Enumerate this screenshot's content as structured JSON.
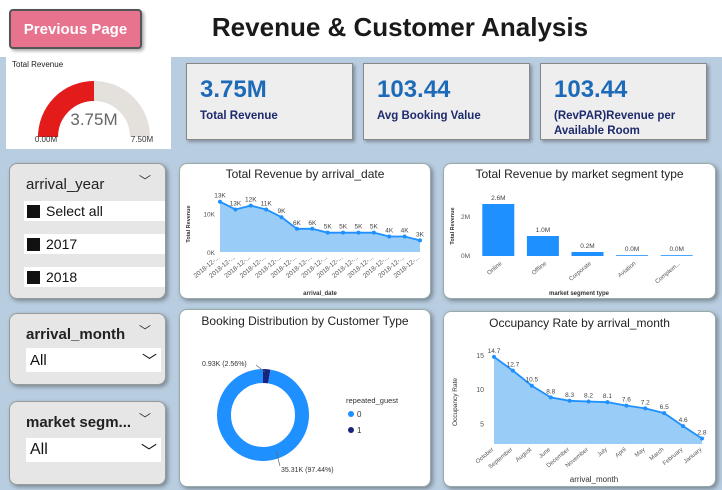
{
  "header": {
    "prev_label": "Previous Page",
    "title": "Revenue & Customer Analysis"
  },
  "gauge": {
    "label": "Total Revenue",
    "value_text": "3.75M",
    "min_text": "0.00M",
    "max_text": "7.50M",
    "fill_fraction": 0.5,
    "fill_color": "#e31b1b",
    "track_color": "#e4e0dc"
  },
  "kpis": [
    {
      "value": "3.75M",
      "label": "Total Revenue"
    },
    {
      "value": "103.44",
      "label": "Avg Booking Value"
    },
    {
      "value": "103.44",
      "label": "(RevPAR)Revenue per Available Room"
    }
  ],
  "slicers": {
    "year": {
      "title": "arrival_year",
      "options": [
        "Select all",
        "2017",
        "2018"
      ]
    },
    "month": {
      "title": "arrival_month",
      "selected": "All"
    },
    "segment": {
      "title": "market segm...",
      "selected": "All"
    }
  },
  "chart_data": [
    {
      "type": "area",
      "title": "Total Revenue by arrival_date",
      "xlabel": "arrival_date",
      "ylabel": "Total Revenue",
      "y_ticks": [
        "10K",
        "0K"
      ],
      "ylim": [
        0,
        15
      ],
      "x": [
        "2018-12-...",
        "2018-12-...",
        "2018-12-...",
        "2018-12-...",
        "2018-12-...",
        "2018-12-...",
        "2018-12-...",
        "2018-12-...",
        "2018-12-...",
        "2018-12-...",
        "2018-12-...",
        "2018-12-...",
        "2018-12-...",
        "2018-12-..."
      ],
      "values": [
        13,
        11,
        12,
        11,
        9,
        6,
        6,
        5,
        5,
        5,
        5,
        4,
        4,
        3
      ],
      "labels": [
        "13K",
        "13K",
        "12K",
        "11K",
        "9K",
        "6K",
        "6K",
        "5K",
        "5K",
        "5K",
        "5K",
        "4K",
        "4K",
        "3K"
      ],
      "color": "#1e90ff"
    },
    {
      "type": "bar",
      "title": "Total Revenue by market segment type",
      "xlabel": "market segment type",
      "ylabel": "Total Revenue",
      "y_ticks": [
        "2M",
        "0M"
      ],
      "ylim": [
        0,
        3
      ],
      "categories": [
        "Online",
        "Offline",
        "Corporate",
        "Aviation",
        "Complem..."
      ],
      "values": [
        2.6,
        1.0,
        0.2,
        0.0,
        0.0
      ],
      "labels": [
        "2.6M",
        "1.0M",
        "0.2M",
        "0.0M",
        "0.0M"
      ],
      "color": "#1e90ff"
    },
    {
      "type": "pie",
      "title": "Booking Distribution by Customer Type",
      "legend_title": "repeated_guest",
      "series": [
        {
          "name": "0",
          "value": 35.31,
          "label": "35.31K (97.44%)",
          "color": "#1e90ff"
        },
        {
          "name": "1",
          "value": 0.93,
          "label": "0.93K (2.56%)",
          "color": "#1a237e"
        }
      ]
    },
    {
      "type": "area",
      "title": "Occupancy Rate by arrival_month",
      "xlabel": "arrival_month",
      "ylabel": "Occupancy Rate",
      "y_ticks": [
        "15",
        "10",
        "5"
      ],
      "ylim": [
        2,
        16
      ],
      "x": [
        "October",
        "September",
        "August",
        "June",
        "December",
        "November",
        "July",
        "April",
        "May",
        "March",
        "February",
        "January"
      ],
      "values": [
        14.7,
        12.7,
        10.5,
        8.8,
        8.3,
        8.2,
        8.1,
        7.6,
        7.2,
        6.5,
        4.6,
        2.8
      ],
      "labels": [
        "14.7",
        "12.7",
        "10.5",
        "8.8",
        "8.3",
        "8.2",
        "8.1",
        "7.6",
        "7.2",
        "6.5",
        "4.6",
        "2.8"
      ],
      "color": "#1e90ff"
    }
  ]
}
